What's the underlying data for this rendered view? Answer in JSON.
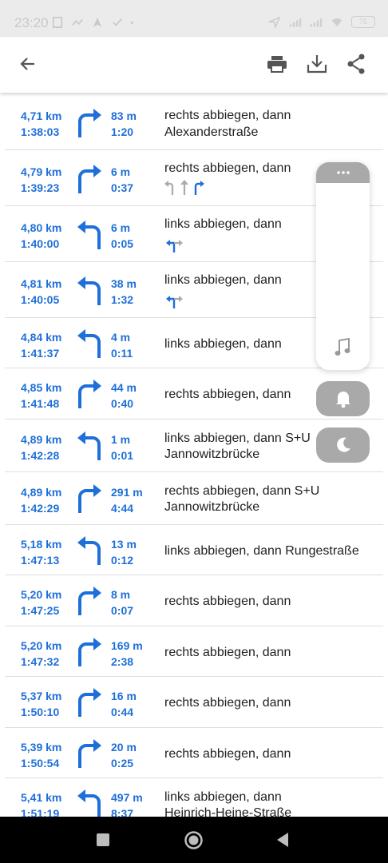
{
  "status": {
    "time": "23:20",
    "battery": "75"
  },
  "icons": {
    "back": "arrow-back-icon",
    "print": "print-icon",
    "download": "download-icon",
    "share": "share-icon"
  },
  "colors": {
    "accent": "#1e6fd9"
  },
  "steps": [
    {
      "dist": "4,71 km",
      "time": "1:38:03",
      "turn": "right",
      "seg": "83 m",
      "seg_time": "1:20",
      "line1": "rechts abbiegen, dann",
      "line2": "Alexanderstraße",
      "lanes": ""
    },
    {
      "dist": "4,79 km",
      "time": "1:39:23",
      "turn": "right",
      "seg": "6 m",
      "seg_time": "0:37",
      "line1": "rechts abbiegen, dann",
      "line2": "",
      "lanes": "three"
    },
    {
      "dist": "4,80 km",
      "time": "1:40:00",
      "turn": "left",
      "seg": "6 m",
      "seg_time": "0:05",
      "line1": "links abbiegen, dann",
      "line2": "",
      "lanes": "split"
    },
    {
      "dist": "4,81 km",
      "time": "1:40:05",
      "turn": "left",
      "seg": "38 m",
      "seg_time": "1:32",
      "line1": "links abbiegen, dann",
      "line2": "",
      "lanes": "split"
    },
    {
      "dist": "4,84 km",
      "time": "1:41:37",
      "turn": "left",
      "seg": "4 m",
      "seg_time": "0:11",
      "line1": "links abbiegen, dann",
      "line2": "",
      "lanes": ""
    },
    {
      "dist": "4,85 km",
      "time": "1:41:48",
      "turn": "right",
      "seg": "44 m",
      "seg_time": "0:40",
      "line1": "rechts abbiegen, dann",
      "line2": "",
      "lanes": ""
    },
    {
      "dist": "4,89 km",
      "time": "1:42:28",
      "turn": "left",
      "seg": "1 m",
      "seg_time": "0:01",
      "line1": "links abbiegen, dann S+U",
      "line2": "Jannowitzbrücke",
      "lanes": ""
    },
    {
      "dist": "4,89 km",
      "time": "1:42:29",
      "turn": "right",
      "seg": "291 m",
      "seg_time": "4:44",
      "line1": "rechts abbiegen, dann S+U",
      "line2": "Jannowitzbrücke",
      "lanes": ""
    },
    {
      "dist": "5,18 km",
      "time": "1:47:13",
      "turn": "left",
      "seg": "13 m",
      "seg_time": "0:12",
      "line1": "links abbiegen, dann Rungestraße",
      "line2": "",
      "lanes": ""
    },
    {
      "dist": "5,20 km",
      "time": "1:47:25",
      "turn": "right",
      "seg": "8 m",
      "seg_time": "0:07",
      "line1": "rechts abbiegen, dann",
      "line2": "",
      "lanes": ""
    },
    {
      "dist": "5,20 km",
      "time": "1:47:32",
      "turn": "right",
      "seg": "169 m",
      "seg_time": "2:38",
      "line1": "rechts abbiegen, dann",
      "line2": "",
      "lanes": ""
    },
    {
      "dist": "5,37 km",
      "time": "1:50:10",
      "turn": "right",
      "seg": "16 m",
      "seg_time": "0:44",
      "line1": "rechts abbiegen, dann",
      "line2": "",
      "lanes": ""
    },
    {
      "dist": "5,39 km",
      "time": "1:50:54",
      "turn": "right",
      "seg": "20 m",
      "seg_time": "0:25",
      "line1": "rechts abbiegen, dann",
      "line2": "",
      "lanes": ""
    },
    {
      "dist": "5,41 km",
      "time": "1:51:19",
      "turn": "left",
      "seg": "497 m",
      "seg_time": "8:37",
      "line1": "links abbiegen, dann",
      "line2": "Heinrich-Heine-Straße",
      "lanes": ""
    }
  ],
  "floating": {
    "panel_icon": "music-note-icon",
    "bell_icon": "bell-icon",
    "moon_icon": "moon-icon",
    "handle_icon": "more-dots-icon"
  },
  "navbar": {
    "recent": "square-icon",
    "home": "circle-icon",
    "back": "triangle-back-icon"
  }
}
